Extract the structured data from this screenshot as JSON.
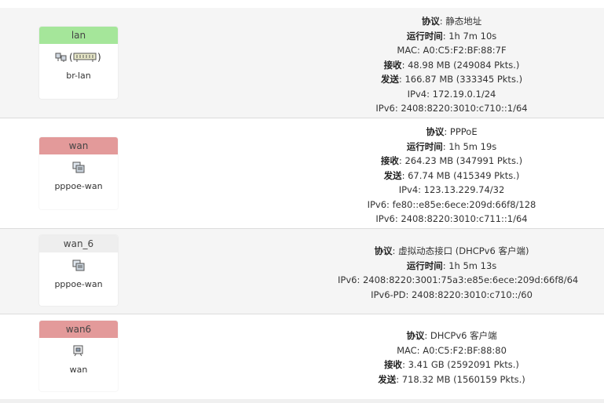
{
  "interfaces": [
    {
      "name": "lan",
      "color": "#a5e69a",
      "device": "br-lan",
      "icons": [
        "ethernet-adapter-icon",
        "bridge-icon"
      ],
      "lines": [
        {
          "key": "协议",
          "sep": ": ",
          "value": "静态地址"
        },
        {
          "key": "运行时间",
          "sep": ": ",
          "value": "1h 7m 10s"
        },
        {
          "key": "",
          "sep": "",
          "value": "MAC: A0:C5:F2:BF:88:7F"
        },
        {
          "key": "接收",
          "sep": ": ",
          "value": "48.98 MB (249084 Pkts.)"
        },
        {
          "key": "发送",
          "sep": ": ",
          "value": "166.87 MB (333345 Pkts.)"
        },
        {
          "key": "",
          "sep": "",
          "value": "IPv4: 172.19.0.1/24"
        },
        {
          "key": "",
          "sep": "",
          "value": "IPv6: 2408:8220:3010:c710::1/64"
        }
      ]
    },
    {
      "name": "wan",
      "color": "#e39a9a",
      "device": "pppoe-wan",
      "icons": [
        "tunnel-icon"
      ],
      "lines": [
        {
          "key": "协议",
          "sep": ": ",
          "value": "PPPoE"
        },
        {
          "key": "运行时间",
          "sep": ": ",
          "value": "1h 5m 19s"
        },
        {
          "key": "接收",
          "sep": ": ",
          "value": "264.23 MB (347991 Pkts.)"
        },
        {
          "key": "发送",
          "sep": ": ",
          "value": "67.74 MB (415349 Pkts.)"
        },
        {
          "key": "",
          "sep": "",
          "value": "IPv4: 123.13.229.74/32"
        },
        {
          "key": "",
          "sep": "",
          "value": "IPv6: fe80::e85e:6ece:209d:66f8/128"
        },
        {
          "key": "",
          "sep": "",
          "value": "IPv6: 2408:8220:3010:c711::1/64"
        }
      ]
    },
    {
      "name": "wan_6",
      "color": "#eeeeee",
      "device": "pppoe-wan",
      "icons": [
        "tunnel-icon"
      ],
      "lines": [
        {
          "key": "协议",
          "sep": ": ",
          "value": "虚拟动态接口 (DHCPv6 客户端)"
        },
        {
          "key": "运行时间",
          "sep": ": ",
          "value": "1h 5m 13s"
        },
        {
          "key": "",
          "sep": "",
          "value": "IPv6: 2408:8220:3001:75a3:e85e:6ece:209d:66f8/64"
        },
        {
          "key": "",
          "sep": "",
          "value": "IPv6-PD: 2408:8220:3010:c710::/60"
        }
      ]
    },
    {
      "name": "wan6",
      "color": "#e39a9a",
      "device": "wan",
      "icons": [
        "ethernet-port-icon"
      ],
      "lines": [
        {
          "key": "协议",
          "sep": ": ",
          "value": "DHCPv6 客户端"
        },
        {
          "key": "",
          "sep": "",
          "value": "MAC: A0:C5:F2:BF:88:80"
        },
        {
          "key": "接收",
          "sep": ": ",
          "value": "3.41 GB (2592091 Pkts.)"
        },
        {
          "key": "发送",
          "sep": ": ",
          "value": "718.32 MB (1560159 Pkts.)"
        }
      ]
    }
  ]
}
